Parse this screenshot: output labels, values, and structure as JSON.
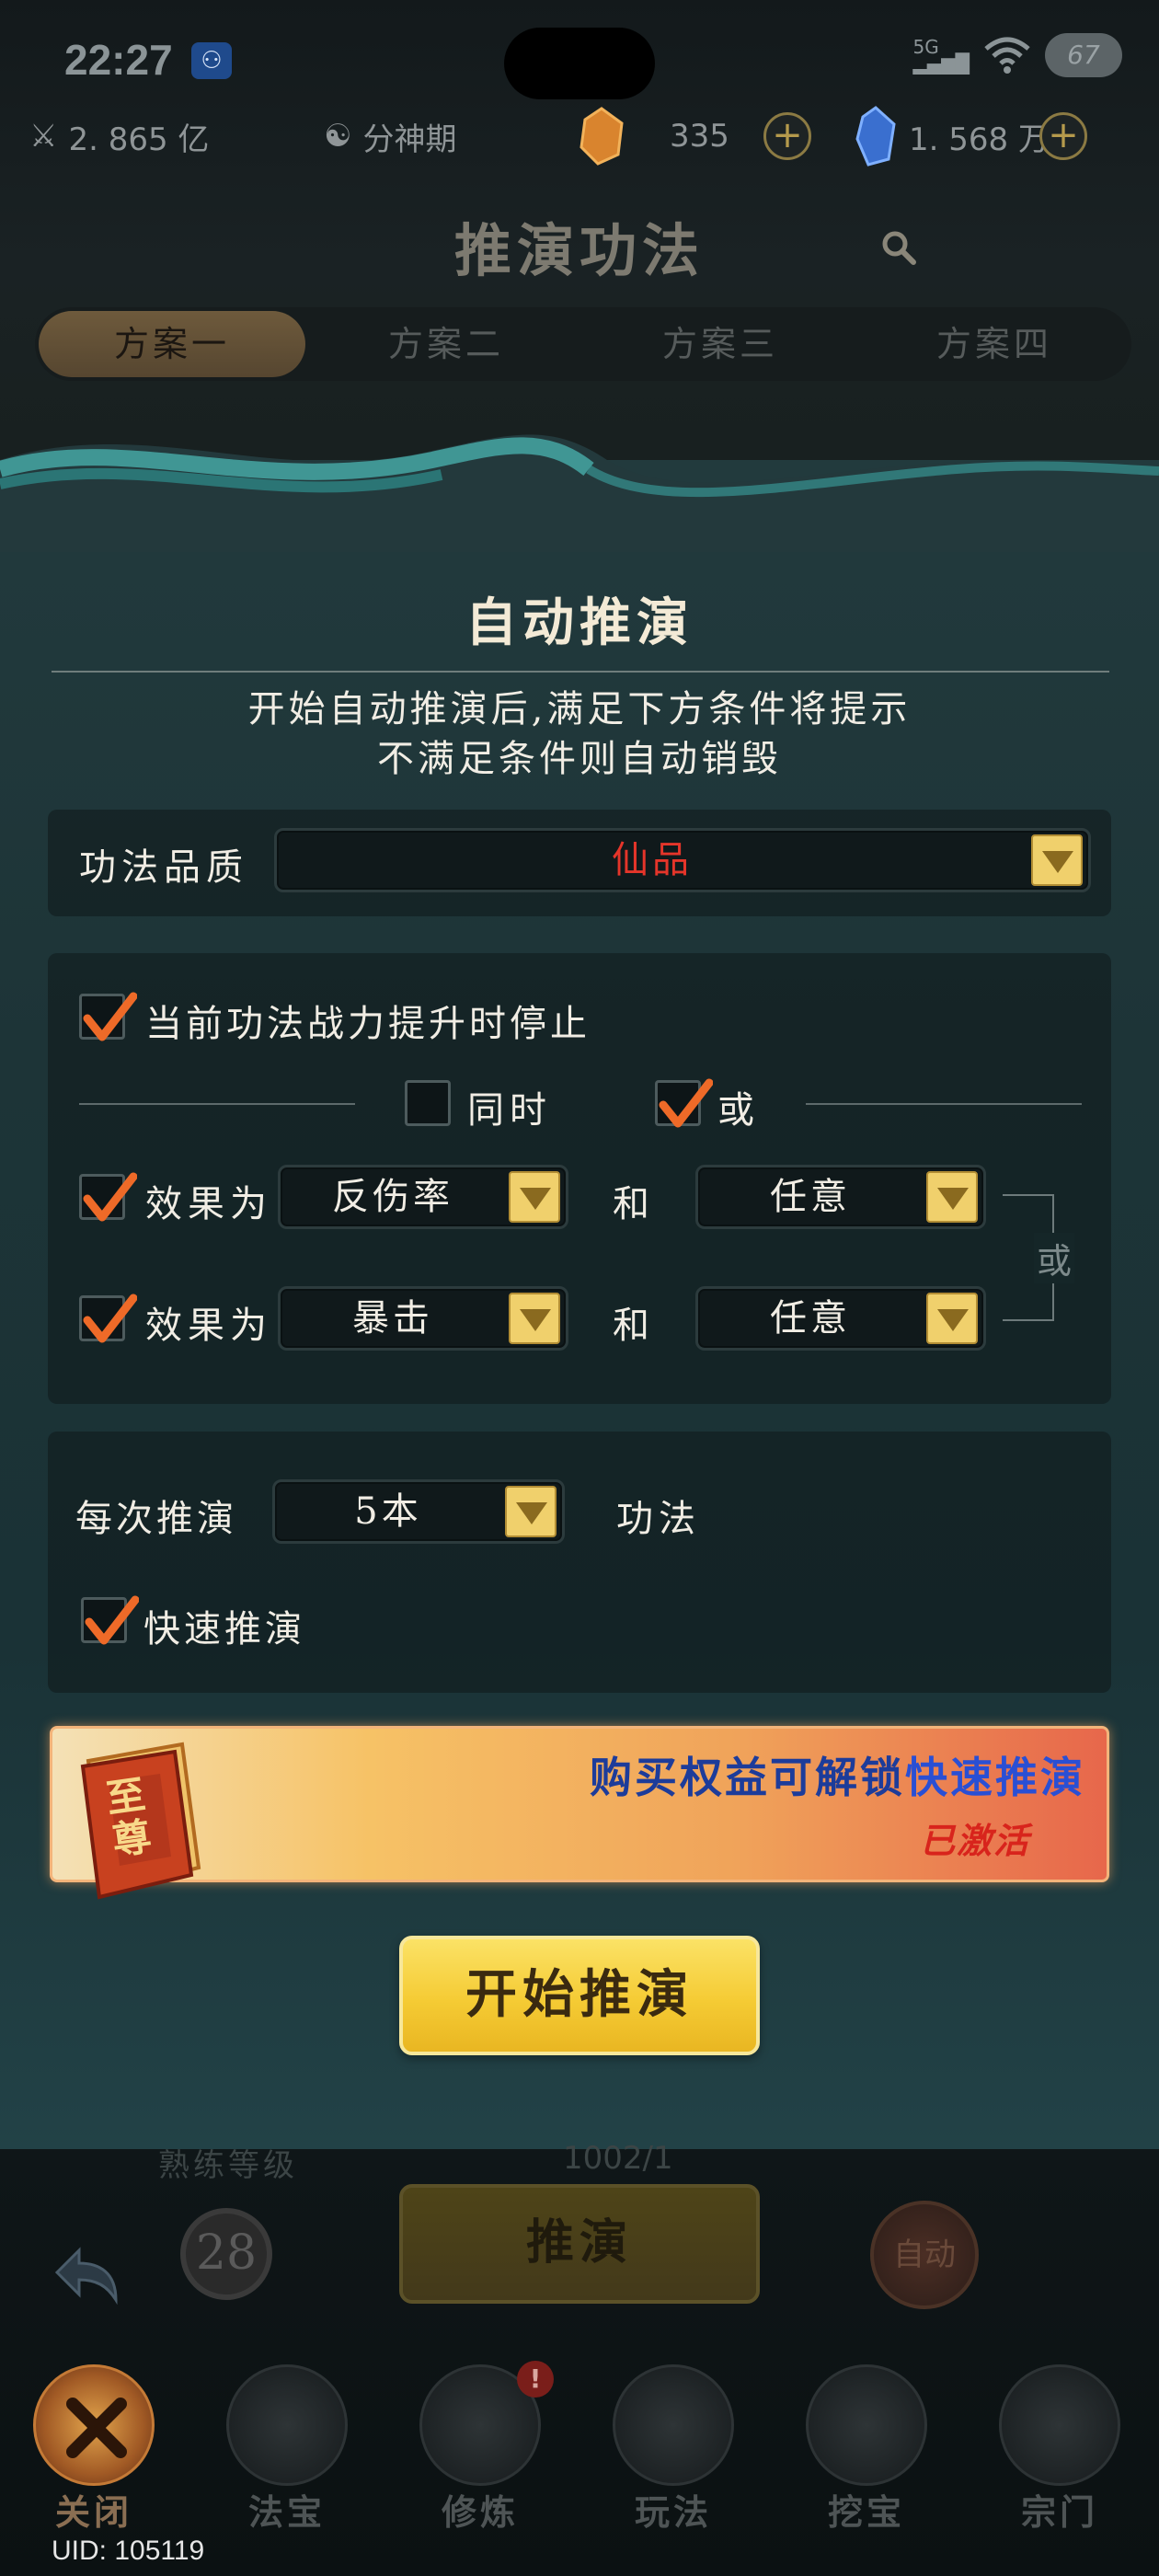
{
  "status_bar": {
    "time": "22:27",
    "app_icon": "tooth-icon",
    "network": "5G",
    "battery": "67"
  },
  "resources": {
    "power": "2. 865 亿",
    "realm": "分神期",
    "spirit_stones": "335",
    "gems": "1. 568 万",
    "plus": "+"
  },
  "header": {
    "title": "推演功法"
  },
  "plans": {
    "tabs": [
      "方案一",
      "方案二",
      "方案三",
      "方案四"
    ],
    "active_index": 0
  },
  "auto_deduce": {
    "title": "自动推演",
    "intro_line1": "开始自动推演后,满足下方条件将提示",
    "intro_line2": "不满足条件则自动销毁",
    "quality_label": "功法品质",
    "quality_value": "仙品",
    "quality_color": "#e5352a",
    "stop_on_power_up": {
      "label": "当前功法战力提升时停止",
      "checked": true
    },
    "mode_both": {
      "label": "同时",
      "checked": false
    },
    "mode_or": {
      "label": "或",
      "checked": true
    },
    "effects": [
      {
        "label": "效果为",
        "checked": true,
        "value1": "反伤率",
        "and": "和",
        "value2": "任意"
      },
      {
        "label": "效果为",
        "checked": true,
        "value1": "暴击",
        "and": "和",
        "value2": "任意"
      }
    ],
    "group_or_label": "或",
    "per_deduce_label": "每次推演",
    "per_deduce_value": "5本",
    "per_deduce_unit": "功法",
    "fast_deduce": {
      "label": "快速推演",
      "checked": true
    }
  },
  "banner": {
    "book_text": "至尊",
    "text_prefix": "购买权益可解锁",
    "text_highlight": "快速推演",
    "status": "已激活"
  },
  "start_button": "开始推演",
  "background_panel": {
    "proficiency_label": "熟练等级",
    "proficiency_level": "28",
    "count": "1002/1",
    "deduce_button": "推演",
    "auto_button": "自动"
  },
  "bottom_nav": {
    "items": [
      {
        "label": "关闭",
        "icon": "close-cross-icon",
        "active": true
      },
      {
        "label": "法宝",
        "icon": "artifact-icon",
        "active": false
      },
      {
        "label": "修炼",
        "icon": "meditation-icon",
        "active": false,
        "badge": "!"
      },
      {
        "label": "玩法",
        "icon": "gameplay-icon",
        "active": false
      },
      {
        "label": "挖宝",
        "icon": "shovel-icon",
        "active": false
      },
      {
        "label": "宗门",
        "icon": "pagoda-icon",
        "active": false
      }
    ]
  },
  "uid": "UID: 105119",
  "colors": {
    "accent_gold": "#f0d06c",
    "check_orange": "#ee6a28",
    "banner_blue": "#1d3c9a",
    "activated_red": "#d8241c"
  }
}
